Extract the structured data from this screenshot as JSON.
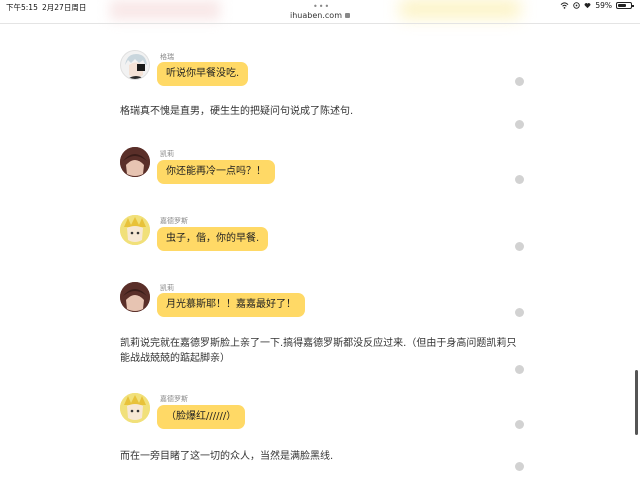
{
  "status": {
    "time": "下午5:15",
    "date": "2月27日周日",
    "battery": "59%",
    "battery_level": 0.59
  },
  "browser": {
    "url": "ihuaben.com"
  },
  "messages": [
    {
      "name": "格瑞",
      "text": "听说你早餐没吃."
    },
    {
      "name": "凯莉",
      "text": "你还能再冷一点吗？！"
    },
    {
      "name": "嘉德罗斯",
      "text": "虫子，偕，你的早餐."
    },
    {
      "name": "凯莉",
      "text": "月光慕斯耶！！嘉嘉最好了！"
    },
    {
      "name": "嘉德罗斯",
      "text": "（脸爆红//////）"
    }
  ],
  "narrations": [
    "格瑞真不愧是直男，硬生生的把疑问句说成了陈述句.",
    "凯莉说完就在嘉德罗斯脸上亲了一下.搞得嘉德罗斯都没反应过来.（但由于身高问题凯莉只能战战兢兢的踮起脚亲）",
    "而在一旁目睹了这一切的众人，当然是满脸黑线."
  ],
  "colors": {
    "bubble": "#ffd966",
    "name": "#888888",
    "dot": "#d2d2d2"
  }
}
